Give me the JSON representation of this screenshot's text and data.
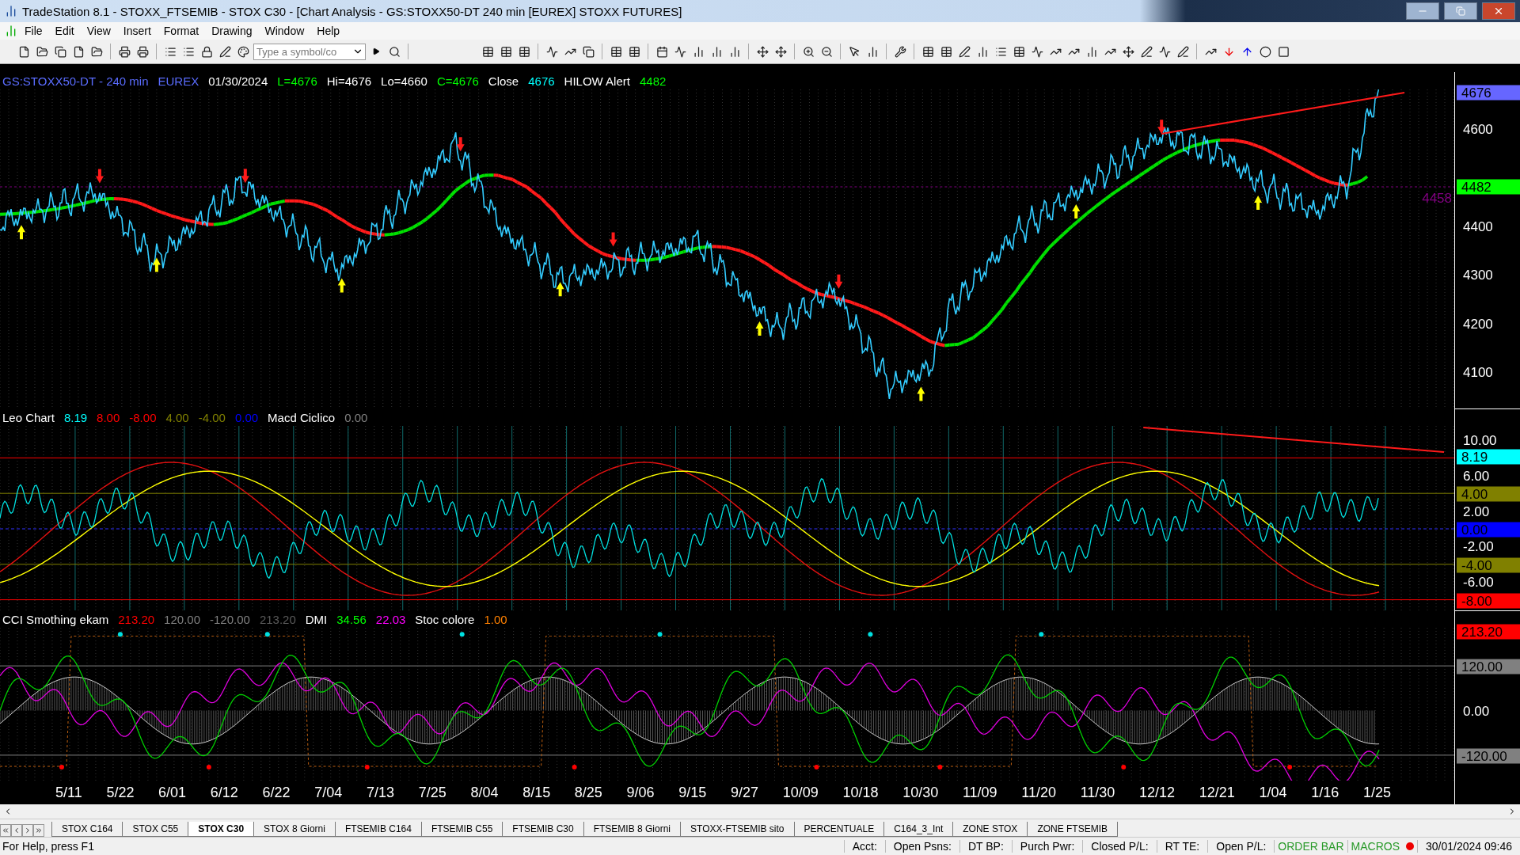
{
  "window": {
    "title": "TradeStation 8.1 - STOXX_FTSEMIB - STOX  C30 - [Chart Analysis - GS:STOXX50-DT  240 min  [EUREX] STOXX FUTURES]"
  },
  "menu": [
    "File",
    "Edit",
    "View",
    "Insert",
    "Format",
    "Drawing",
    "Window",
    "Help"
  ],
  "toolbar": {
    "symbol_field": {
      "placeholder": "Type a symbol/co"
    }
  },
  "panes": [
    {
      "kind": "price",
      "legend": [
        {
          "text": "GS:STOXX50-DT - 240 min",
          "color": "#5a6cff"
        },
        {
          "text": "EUREX",
          "color": "#5a6cff"
        },
        {
          "text": "01/30/2024",
          "color": "#ffffff"
        },
        {
          "text": "L=4676",
          "color": "#00ff00"
        },
        {
          "text": "Hi=4676",
          "color": "#ffffff"
        },
        {
          "text": "Lo=4660",
          "color": "#ffffff"
        },
        {
          "text": "C=4676",
          "color": "#00ff00"
        },
        {
          "text": "Close",
          "color": "#ffffff"
        },
        {
          "text": "4676",
          "color": "#00ffff"
        },
        {
          "text": "HILOW Alert",
          "color": "#ffffff"
        },
        {
          "text": "4482",
          "color": "#00ff00"
        }
      ],
      "ticks": [
        "4600",
        "4400",
        "4300",
        "4200",
        "4100"
      ],
      "badges": [
        {
          "text": "4676",
          "color": "#6666ff"
        },
        {
          "text": "4482",
          "color": "#00ff00"
        }
      ],
      "level_label": {
        "text": "4458",
        "color": "#800080"
      }
    },
    {
      "kind": "oscillator",
      "legend": [
        {
          "text": "Leo Chart",
          "color": "#ffffff"
        },
        {
          "text": "8.19",
          "color": "#00ffff"
        },
        {
          "text": "8.00",
          "color": "#ff0000"
        },
        {
          "text": "-8.00",
          "color": "#ff0000"
        },
        {
          "text": "4.00",
          "color": "#808000"
        },
        {
          "text": "-4.00",
          "color": "#808000"
        },
        {
          "text": "0.00",
          "color": "#0000ff"
        },
        {
          "text": "Macd Ciclico",
          "color": "#ffffff"
        },
        {
          "text": "0.00",
          "color": "#808080"
        }
      ],
      "ticks": [
        "10.00",
        "6.00",
        "2.00",
        "-2.00",
        "-6.00"
      ],
      "badges": [
        {
          "text": "8.19",
          "color": "#00ffff"
        },
        {
          "text": "4.00",
          "color": "#808000"
        },
        {
          "text": "0.00",
          "color": "#0000ff"
        },
        {
          "text": "-4.00",
          "color": "#808000"
        },
        {
          "text": "-8.00",
          "color": "#ff0000"
        }
      ]
    },
    {
      "kind": "cci",
      "legend": [
        {
          "text": "CCI Smothing ekam",
          "color": "#ffffff"
        },
        {
          "text": "213.20",
          "color": "#ff0000"
        },
        {
          "text": "120.00",
          "color": "#808080"
        },
        {
          "text": "-120.00",
          "color": "#808080"
        },
        {
          "text": "213.20",
          "color": "#5a5a5a"
        },
        {
          "text": "DMI",
          "color": "#ffffff"
        },
        {
          "text": "34.56",
          "color": "#00ff00"
        },
        {
          "text": "22.03",
          "color": "#ff00ff"
        },
        {
          "text": "Stoc colore",
          "color": "#ffffff"
        },
        {
          "text": "1.00",
          "color": "#ff8000"
        }
      ],
      "ticks": [
        "0.00"
      ],
      "badges": [
        {
          "text": "213.20",
          "color": "#ff0000"
        },
        {
          "text": "120.00",
          "color": "#808080"
        },
        {
          "text": "-120.00",
          "color": "#808080"
        }
      ]
    }
  ],
  "dates": [
    "5/11",
    "5/22",
    "6/01",
    "6/12",
    "6/22",
    "7/04",
    "7/13",
    "7/25",
    "8/04",
    "8/15",
    "8/25",
    "9/06",
    "9/15",
    "9/27",
    "10/09",
    "10/18",
    "10/30",
    "11/09",
    "11/20",
    "11/30",
    "12/12",
    "12/21",
    "1/04",
    "1/16",
    "1/25"
  ],
  "tabs": [
    {
      "label": "STOX C164",
      "selected": false
    },
    {
      "label": "STOX C55",
      "selected": false
    },
    {
      "label": "STOX  C30",
      "selected": true
    },
    {
      "label": "STOX  8 Giorni",
      "selected": false
    },
    {
      "label": "FTSEMIB C164",
      "selected": false
    },
    {
      "label": "FTSEMIB C55",
      "selected": false
    },
    {
      "label": "FTSEMIB C30",
      "selected": false
    },
    {
      "label": "FTSEMIB  8 Giorni",
      "selected": false
    },
    {
      "label": "STOXX-FTSEMIB sito",
      "selected": false
    },
    {
      "label": "PERCENTUALE",
      "selected": false
    },
    {
      "label": "C164_3_Int",
      "selected": false
    },
    {
      "label": "ZONE STOX",
      "selected": false
    },
    {
      "label": "ZONE FTSEMIB",
      "selected": false
    }
  ],
  "status_bar": {
    "help": "For Help, press F1",
    "fields": [
      "Acct:",
      "Open Psns:",
      "DT BP:",
      "Purch Pwr:",
      "Closed P/L:",
      "RT TE:",
      "Open P/L:"
    ],
    "order_bar": "ORDER BAR",
    "macros": "MACROS",
    "datetime": "30/01/2024 09:46"
  }
}
